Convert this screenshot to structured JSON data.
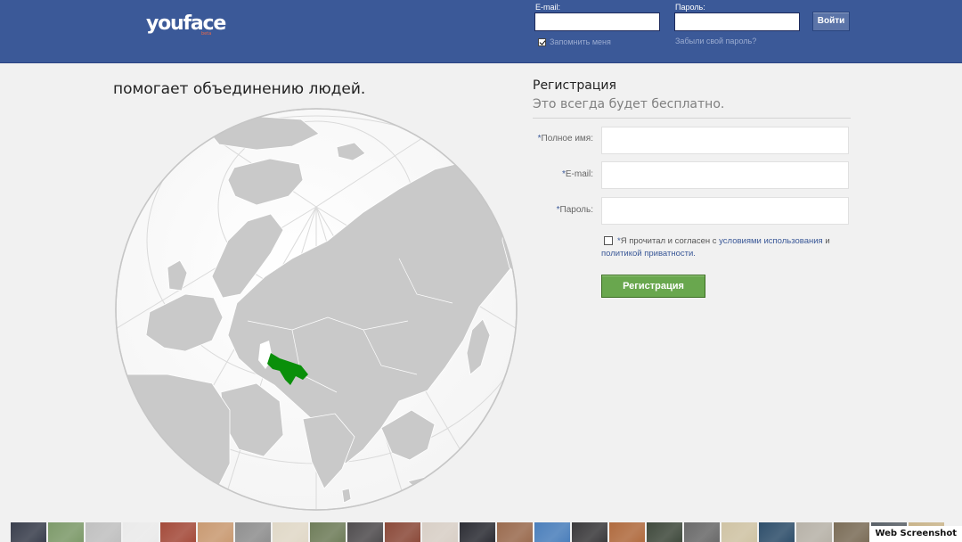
{
  "header": {
    "logo": "youface",
    "logo_sub": "beta",
    "email_label": "E-mail:",
    "password_label": "Пароль:",
    "login_button": "Войти",
    "remember_me": "Запомнить меня",
    "forgot_password": "Забыли свой пароль?"
  },
  "main": {
    "tagline": "помогает объединению людей."
  },
  "registration": {
    "title": "Регистрация",
    "subtitle": "Это всегда будет бесплатно.",
    "fields": [
      {
        "required_mark": "*",
        "label": "Полное имя:"
      },
      {
        "required_mark": "*",
        "label": "E-mail:"
      },
      {
        "required_mark": "*",
        "label": "Пароль:"
      }
    ],
    "terms_required_mark": "*",
    "terms_prefix": "Я прочитал и согласен с ",
    "terms_link": "условиями использования",
    "terms_and": " и",
    "privacy_link": "политикой приватности",
    "terms_end": ".",
    "submit_button": "Регистрация"
  },
  "photo_strip": {
    "thumb_colors": [
      "#3a3f4d",
      "#7d9a6a",
      "#c0c0c0",
      "#eaeaea",
      "#a44b3b",
      "#c99a72",
      "#8f8f8f",
      "#e0d8c7",
      "#6f7d5a",
      "#504d4f",
      "#8b4a3a",
      "#d8cfc6",
      "#2d2e35",
      "#9a6b4f",
      "#4b7fbb",
      "#3b3a3c",
      "#b06b3f",
      "#404a3d",
      "#6a6a6a",
      "#cfc3a4",
      "#2f4f6b",
      "#b7b2a8",
      "#7b6d58",
      "#585f66",
      "#c9b48a",
      "#3d3d42",
      "#8e6a3f",
      "#a7a39c",
      "#d2c6a8",
      "#6c5a4b",
      "#3a3a3a",
      "#c45c4c",
      "#6e6e6e",
      "#b9a27e"
    ],
    "watermark": "Web Screenshot"
  },
  "colors": {
    "header_bg": "#3b5998",
    "page_bg": "#f1f1f1",
    "highlight_country": "#0a8f0a",
    "register_button": "#69a74e"
  }
}
